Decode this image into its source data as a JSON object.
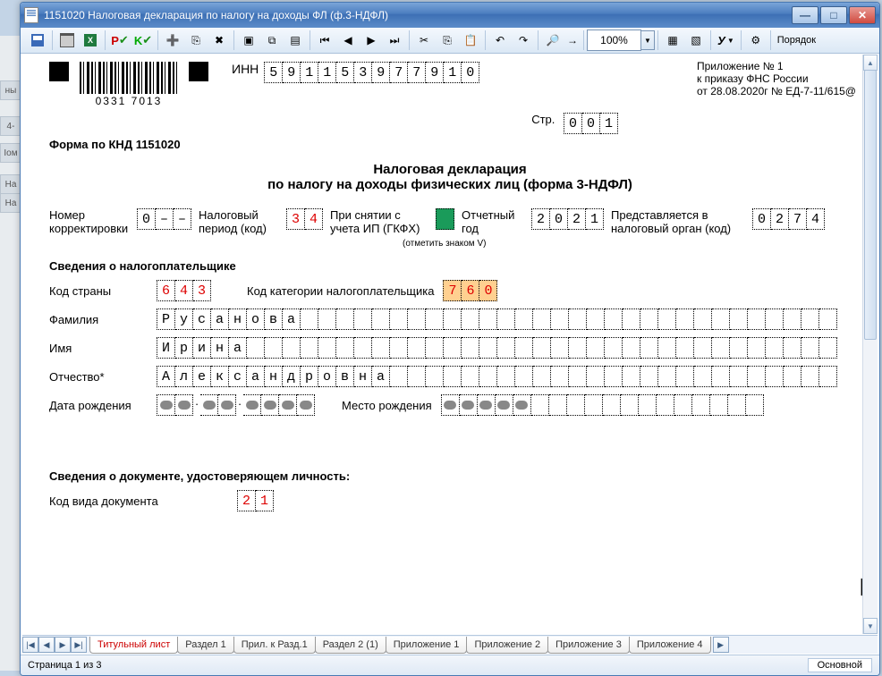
{
  "window": {
    "title": "1151020  Налоговая декларация по налогу на доходы ФЛ (ф.3-НДФЛ)"
  },
  "toolbar": {
    "zoom": "100%",
    "order_label": "Порядок"
  },
  "annex": {
    "l1": "Приложение № 1",
    "l2": "к приказу ФНС России",
    "l3": "от 28.08.2020г № ЕД-7-11/615@"
  },
  "header": {
    "barcode_text": "0331 7013",
    "inn_label": "ИНН",
    "inn": [
      "5",
      "9",
      "1",
      "1",
      "5",
      "3",
      "9",
      "7",
      "7",
      "9",
      "1",
      "0"
    ],
    "page_label": "Стр.",
    "page": [
      "0",
      "0",
      "1"
    ],
    "knd": "Форма по КНД 1151020",
    "title1": "Налоговая декларация",
    "title2": "по налогу на доходы физических лиц (форма 3-НДФЛ)"
  },
  "fields": {
    "corr_label": "Номер корректировки",
    "corr": [
      "0",
      "–",
      "–"
    ],
    "period_label": "Налоговый период (код)",
    "period": [
      "3",
      "4"
    ],
    "ip_label": "При снятии с учета ИП (ГКФХ)",
    "ip_note": "(отметить знаком V)",
    "year_label": "Отчетный год",
    "year": [
      "2",
      "0",
      "2",
      "1"
    ],
    "organ_label": "Представляется в налоговый орган (код)",
    "organ": [
      "0",
      "2",
      "7",
      "4"
    ],
    "section1": "Сведения о налогоплательщике",
    "country_label": "Код страны",
    "country": [
      "6",
      "4",
      "3"
    ],
    "cat_label": "Код категории налогоплательщика",
    "cat": [
      "7",
      "6",
      "0"
    ],
    "surname_label": "Фамилия",
    "surname": [
      "Р",
      "у",
      "с",
      "а",
      "н",
      "о",
      "в",
      "а"
    ],
    "name_label": "Имя",
    "name": [
      "И",
      "р",
      "и",
      "н",
      "а"
    ],
    "patr_label": "Отчество*",
    "patr": [
      "А",
      "л",
      "е",
      "к",
      "с",
      "а",
      "н",
      "д",
      "р",
      "о",
      "в",
      "н",
      "а"
    ],
    "dob_label": "Дата рождения",
    "pob_label": "Место рождения",
    "section2": "Сведения о документе, удостоверяющем личность:",
    "doctype_label": "Код вида документа",
    "doctype": [
      "2",
      "1"
    ]
  },
  "tabs": {
    "items": [
      "Титульный лист",
      "Раздел 1",
      "Прил. к Разд.1",
      "Раздел 2 (1)",
      "Приложение 1",
      "Приложение 2",
      "Приложение 3",
      "Приложение 4"
    ]
  },
  "status": {
    "page": "Страница 1 из 3",
    "mode": "Основной"
  }
}
